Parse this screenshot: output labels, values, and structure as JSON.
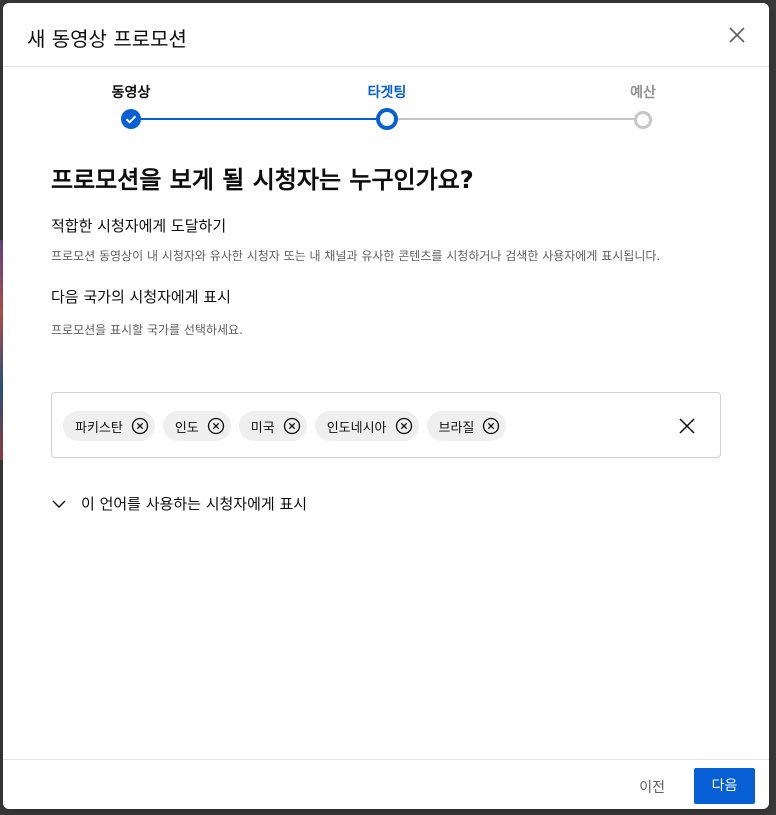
{
  "dialog": {
    "title": "새 동영상 프로모션",
    "close_icon": "close-icon"
  },
  "stepper": {
    "steps": [
      {
        "label": "동영상",
        "state": "completed"
      },
      {
        "label": "타겟팅",
        "state": "active"
      },
      {
        "label": "예산",
        "state": "pending"
      }
    ],
    "colors": {
      "active": "#065fd4",
      "pending": "#c6c6c6"
    }
  },
  "main": {
    "heading": "프로모션을 보게 될 시청자는 누구인가요?",
    "section1_title": "적합한 시청자에게 도달하기",
    "section1_desc": "프로모션 동영상이 내 시청자와 유사한 시청자 또는 내 채널과 유사한 콘텐츠를 시청하거나 검색한 사용자에게 표시됩니다.",
    "section2_title": "다음 국가의 시청자에게 표시",
    "section2_desc": "프로모션을 표시할 국가를 선택하세요."
  },
  "countries": {
    "chips": [
      "파키스탄",
      "인도",
      "미국",
      "인도네시아",
      "브라질"
    ],
    "remove_icon": "remove-circle-icon",
    "clear_icon": "clear-all-icon"
  },
  "language": {
    "label": "이 언어를 사용하는 시청자에게 표시",
    "icon": "chevron-down-icon"
  },
  "footer": {
    "prev_label": "이전",
    "next_label": "다음",
    "accent": "#065fd4"
  }
}
